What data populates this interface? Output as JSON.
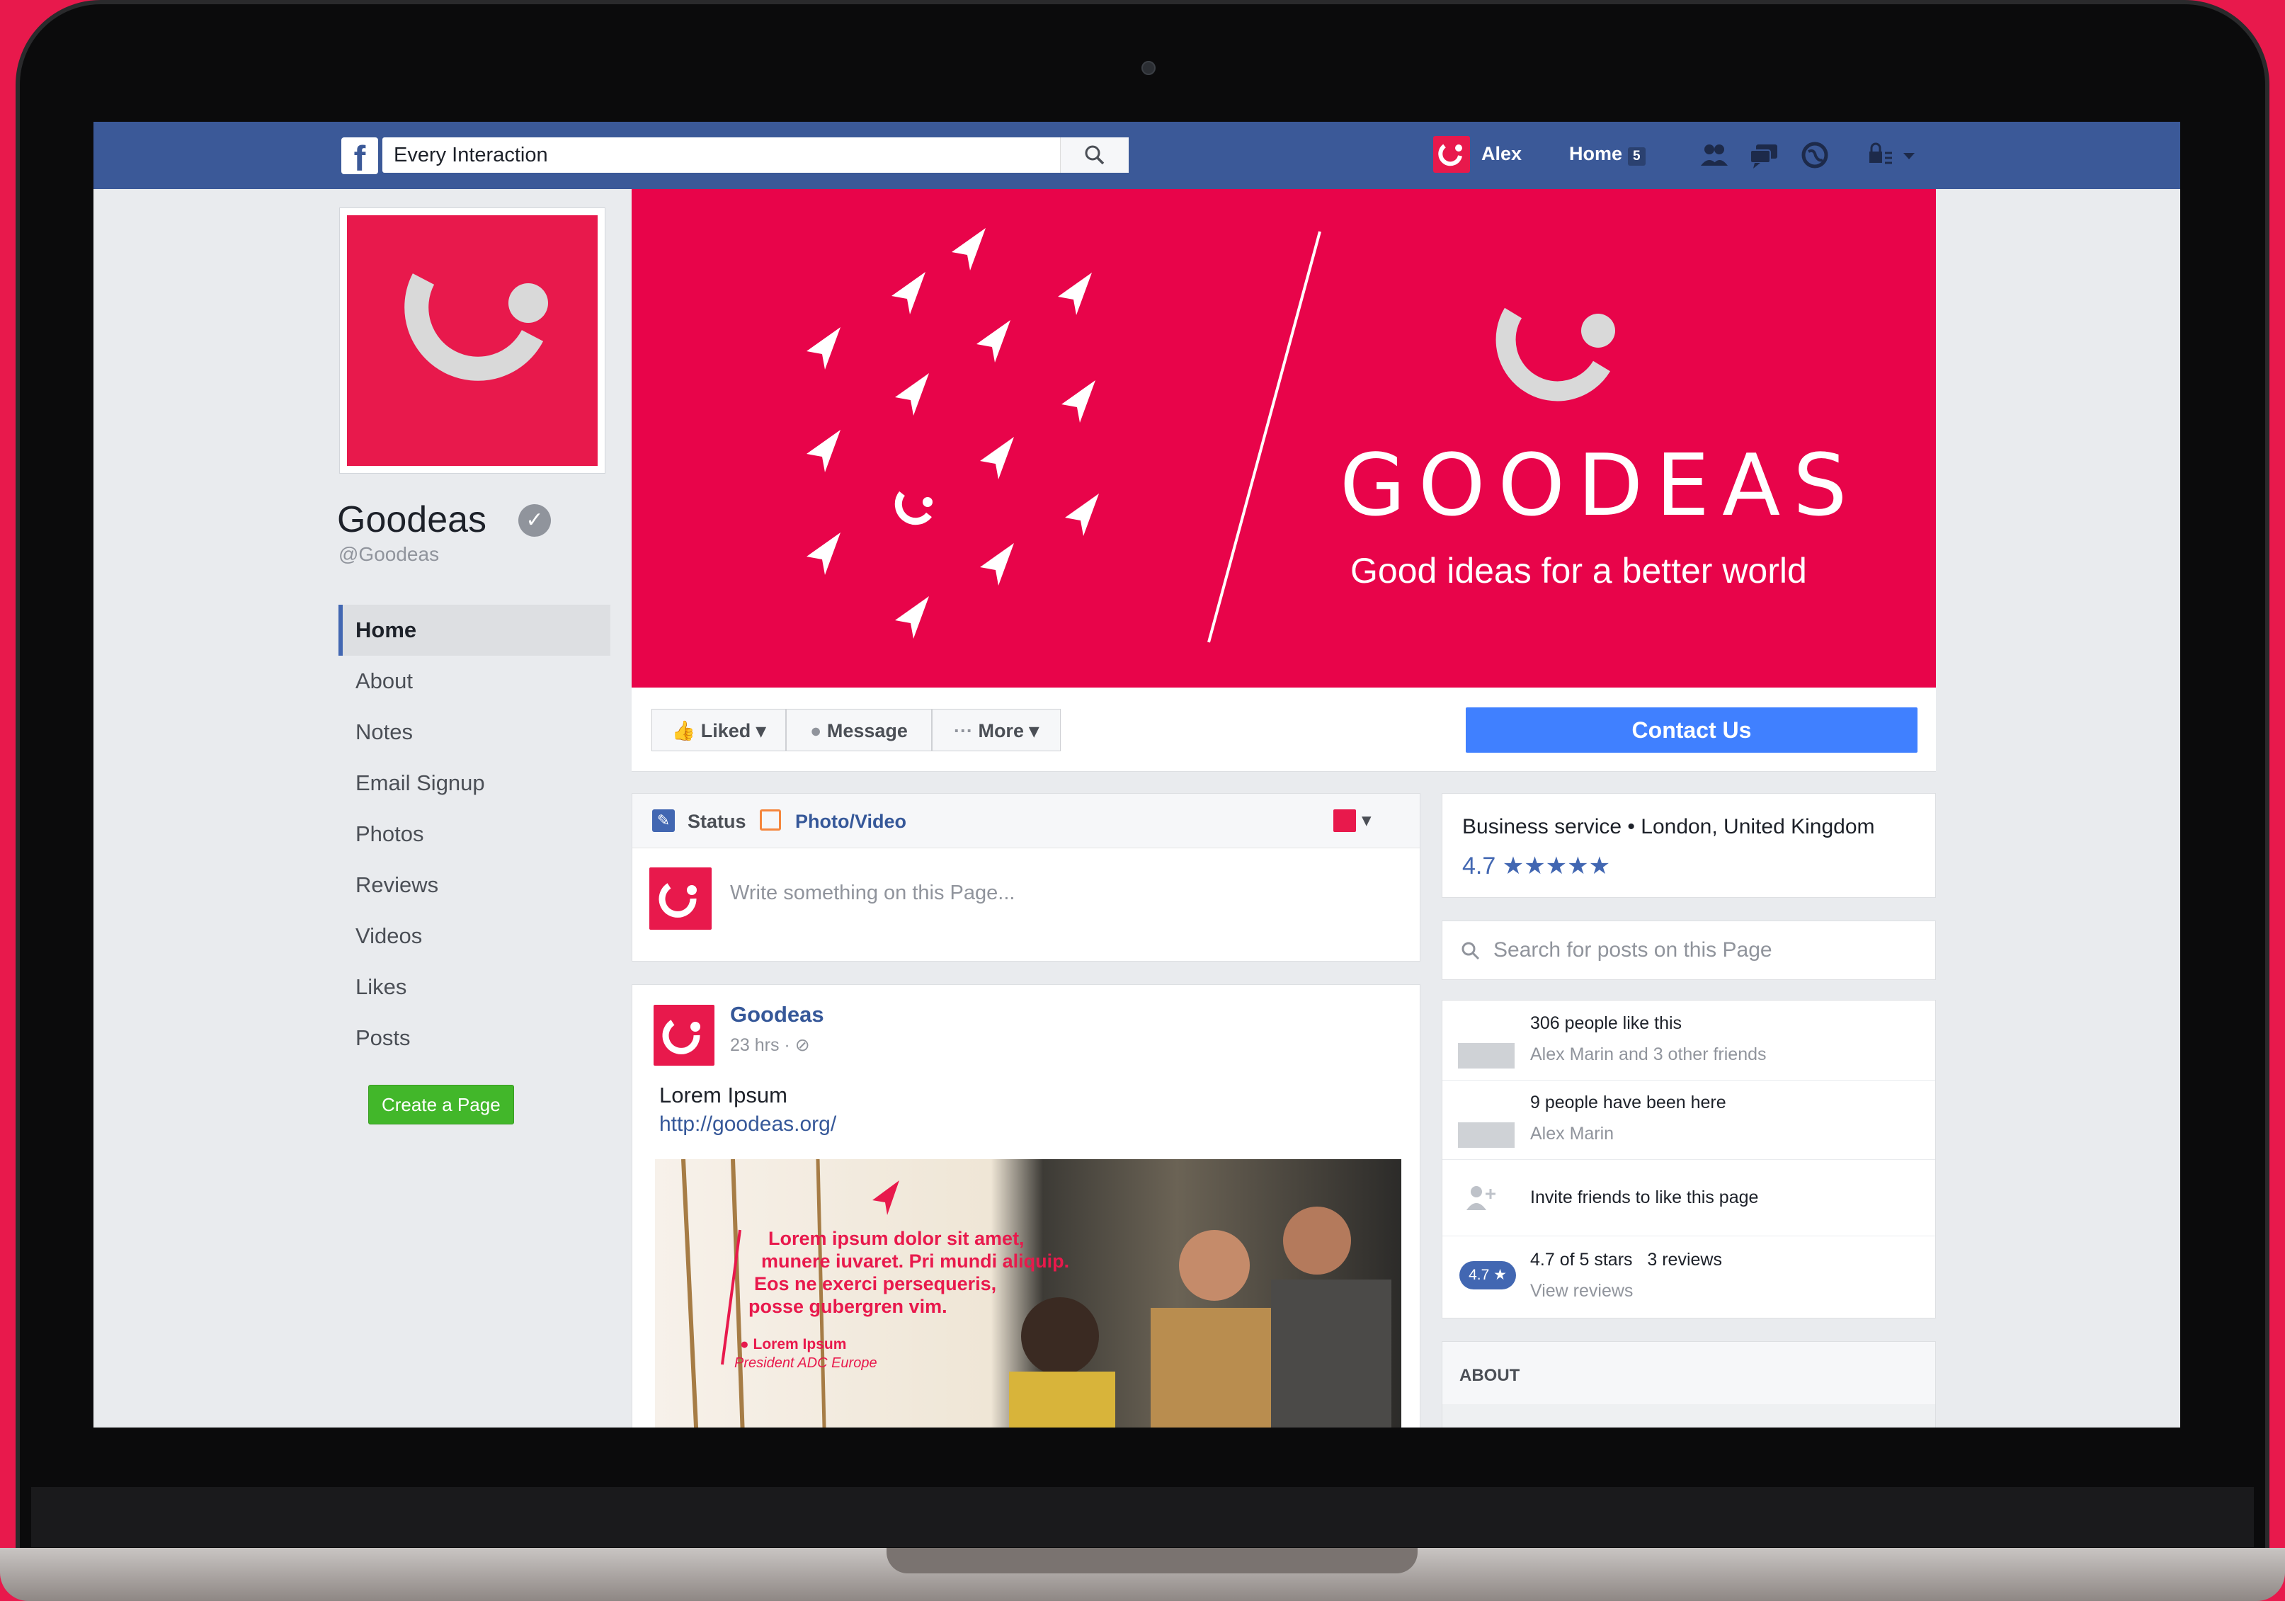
{
  "topbar": {
    "logo": "f",
    "search_value": "Every Interaction",
    "user_name": "Alex",
    "home_label": "Home",
    "home_count": "5"
  },
  "page": {
    "name": "Goodeas",
    "handle": "@Goodeas",
    "nav": [
      "Home",
      "About",
      "Notes",
      "Email Signup",
      "Photos",
      "Reviews",
      "Videos",
      "Likes",
      "Posts"
    ],
    "create_page": "Create a Page"
  },
  "cover": {
    "wordmark": "GOODEAS",
    "tagline": "Good ideas for a better world"
  },
  "actions": {
    "liked": "Liked",
    "message": "Message",
    "more": "More",
    "contact": "Contact Us"
  },
  "composer": {
    "status_tab": "Status",
    "photo_tab": "Photo/Video",
    "placeholder": "Write something on this Page..."
  },
  "post": {
    "author": "Goodeas",
    "time": "23 hrs · ",
    "text": "Lorem Ipsum",
    "link": "http://goodeas.org/",
    "image_quote_1": "Lorem ipsum dolor sit amet,",
    "image_quote_2": "munere iuvaret. Pri mundi aliquip.",
    "image_quote_3": "Eos ne exerci persequeris,",
    "image_quote_4": "posse gubergren vim.",
    "image_author": "Lorem Ipsum",
    "image_role": "President ADC Europe"
  },
  "sidebar": {
    "category": "Business service • London, United Kingdom",
    "rating": "4.7",
    "stars": "★★★★★",
    "search_placeholder": "Search for posts on this Page",
    "likes_main": "306 people like this",
    "likes_sub": "Alex Marin and 3 other friends",
    "visits_main": "9 people have been here",
    "visits_sub": "Alex Marin",
    "invite": "Invite friends to like this page",
    "badge": "4.7 ★",
    "reviews_main": "4.7 of 5 stars",
    "reviews_count": "3 reviews",
    "reviews_link": "View reviews",
    "about_title": "ABOUT"
  },
  "colors": {
    "brand": "#e8194c",
    "facebook_blue": "#3b5998",
    "contact_button": "#4080ff"
  },
  "icons": [
    "search-icon",
    "friends-icon",
    "messages-icon",
    "globe-icon",
    "privacy-icon",
    "chevron-down-icon",
    "thumbs-up-icon",
    "messenger-icon",
    "pencil-icon",
    "photo-icon",
    "globe-small-icon",
    "add-friend-icon"
  ]
}
